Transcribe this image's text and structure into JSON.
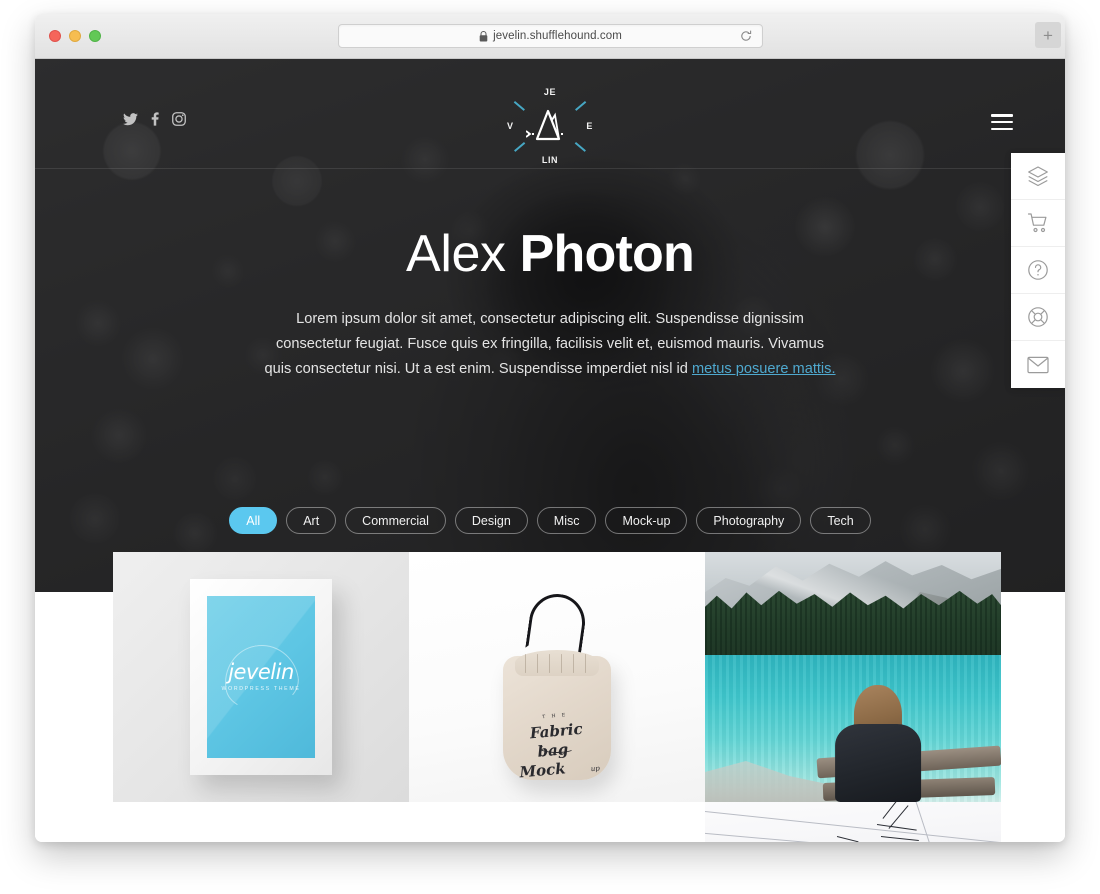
{
  "browser": {
    "url": "jevelin.shufflehound.com",
    "lock_icon": "lock-icon",
    "reload_icon": "reload-icon",
    "new_tab_label": "+",
    "traffic_lights": [
      "close",
      "minimize",
      "maximize"
    ]
  },
  "site": {
    "logo": {
      "top": "JE",
      "left": "V",
      "right": "E",
      "bottom": "LIN",
      "mark": "mountain-icon"
    },
    "social": [
      {
        "name": "twitter-icon",
        "label": "Twitter"
      },
      {
        "name": "facebook-icon",
        "label": "Facebook"
      },
      {
        "name": "instagram-icon",
        "label": "Instagram"
      }
    ],
    "menu_toggle": "hamburger-icon"
  },
  "hero": {
    "title_light": "Alex",
    "title_bold": "Photon",
    "description_part1": "Lorem ipsum dolor sit amet, consectetur adipiscing elit. Suspendisse dignissim consectetur feugiat. Fusce quis ex fringilla, facilisis velit et, euismod mauris. Vivamus quis consectetur nisi. Ut a est enim. Suspendisse imperdiet nisl id ",
    "description_link": "metus posuere mattis."
  },
  "filters": {
    "items": [
      {
        "label": "All",
        "active": true
      },
      {
        "label": "Art",
        "active": false
      },
      {
        "label": "Commercial",
        "active": false
      },
      {
        "label": "Design",
        "active": false
      },
      {
        "label": "Misc",
        "active": false
      },
      {
        "label": "Mock-up",
        "active": false
      },
      {
        "label": "Photography",
        "active": false
      },
      {
        "label": "Tech",
        "active": false
      }
    ]
  },
  "side_dock": {
    "items": [
      {
        "name": "layers-icon",
        "label": "Layers"
      },
      {
        "name": "shopping-cart-icon",
        "label": "Cart"
      },
      {
        "name": "question-mark-icon",
        "label": "Help"
      },
      {
        "name": "lifebuoy-icon",
        "label": "Support"
      },
      {
        "name": "envelope-icon",
        "label": "Contact"
      }
    ]
  },
  "portfolio": {
    "items": [
      {
        "name": "framed-poster",
        "caption": "jevelin",
        "sub_caption": "WORDPRESS THEME"
      },
      {
        "name": "fabric-bag-mockup",
        "caption_the": "T H E",
        "caption_1": "Fabric",
        "caption_2": "bag",
        "caption_3": "Mock",
        "caption_4": "up"
      },
      {
        "name": "lake-mountain-photo",
        "caption": ""
      },
      {
        "name": "blueprint-sketch",
        "caption": ""
      }
    ]
  },
  "colors": {
    "accent": "#5bc8ef",
    "link": "#4fa9cf",
    "hero_bg": "#2b2b2b",
    "page_bg": "#ffffff"
  }
}
